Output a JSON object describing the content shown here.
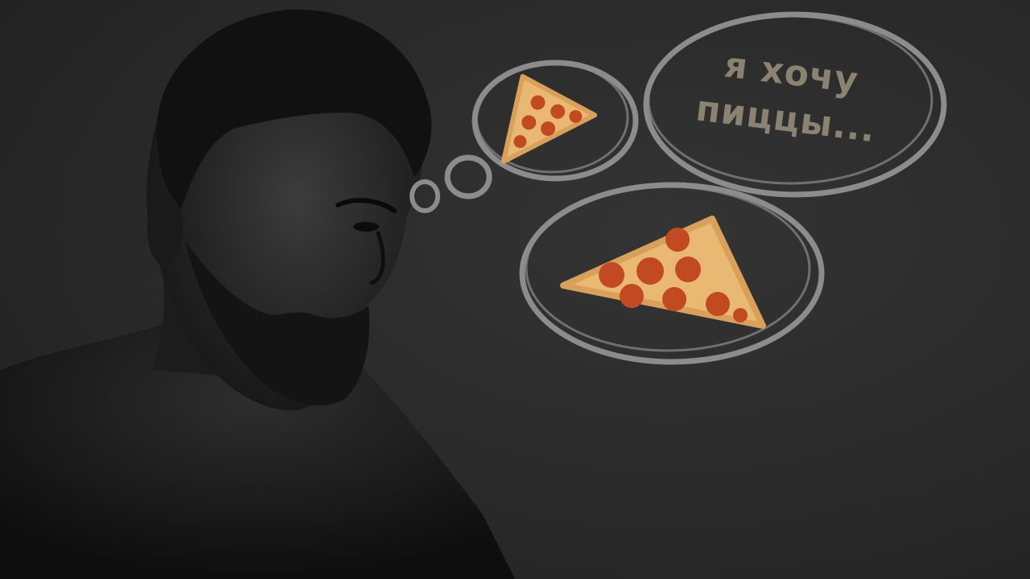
{
  "thought": {
    "line1": "я хочу",
    "line2": "пиццы..."
  },
  "colors": {
    "background": "#2b2b2b",
    "bubble_stroke": "#8c8c8c",
    "text": "#8a8370",
    "pizza_crust": "#d9a05a",
    "pizza_cheese": "#e9b973",
    "pepperoni": "#c24a22"
  },
  "icons": [
    "thought-bubble",
    "pizza-slice-icon",
    "man-silhouette"
  ]
}
